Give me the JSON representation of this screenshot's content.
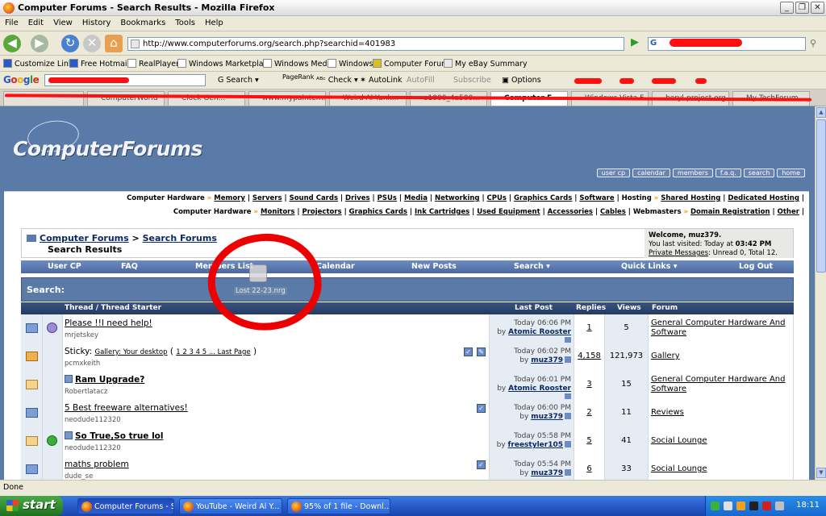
{
  "window": {
    "title": "Computer Forums - Search Results - Mozilla Firefox"
  },
  "menu": [
    "File",
    "Edit",
    "View",
    "History",
    "Bookmarks",
    "Tools",
    "Help"
  ],
  "nav": {
    "url": "http://www.computerforums.org/search.php?searchid=401983"
  },
  "bookmarks": [
    "Customize Links",
    "Free Hotmail",
    "RealPlayer",
    "Windows Marketplace",
    "Windows Media",
    "Windows",
    "Computer Forums",
    "My eBay Summary"
  ],
  "google_toolbar": {
    "logo": "Google",
    "search": "Search",
    "pagerank": "PageRank",
    "check": "Check",
    "autolink": "AutoLink",
    "autofill": "AutoFill",
    "subscribe": "Subscribe",
    "options": "Options"
  },
  "tabs": [
    "ComputerWorld",
    "Clock Gen...",
    "www.mypaintem...",
    "Weird Al Yank...",
    "a1000_4a500...",
    "Computer F...",
    "Windows Vista F...",
    "beryl-project.org",
    "My TechForum..."
  ],
  "site": {
    "logo": "ComputerForums",
    "header_buttons": [
      "user cp",
      "calendar",
      "members",
      "f.a.q.",
      "search",
      "home"
    ],
    "link_row1": {
      "lead": "Computer Hardware",
      "items": [
        "Memory",
        "Servers",
        "Sound Cards",
        "Drives",
        "PSUs",
        "Media",
        "Networking",
        "CPUs",
        "Graphics Cards",
        "Software"
      ],
      "lead2": "Hosting",
      "items2": [
        "Shared Hosting",
        "Dedicated Hosting"
      ]
    },
    "link_row2": {
      "lead": "Computer Hardware",
      "items": [
        "Monitors",
        "Projectors",
        "Graphics Cards",
        "Ink Cartridges",
        "Used Equipment",
        "Accessories",
        "Cables"
      ],
      "lead2": "Webmasters",
      "items2": [
        "Domain Registration",
        "Other"
      ]
    },
    "breadcrumb": {
      "root": "Computer Forums",
      "sep": ">",
      "section": "Search Forums",
      "current": "Search Results"
    },
    "welcome": {
      "line1": "Welcome, muz379.",
      "line2": "You last visited: Today at",
      "time": "03:42 PM",
      "pm_link": "Private Messages",
      "pm_text": ": Unread 0, Total 12."
    },
    "navstrip": [
      "User CP",
      "FAQ",
      "Members List",
      "Calendar",
      "New Posts",
      "Search ▾",
      "Quick Links ▾",
      "Log Out"
    ],
    "search_label": "Search:",
    "drag_label": "Lost 22-23.nrg",
    "table_headers": {
      "thread": "Thread / Thread Starter",
      "lastpost": "Last Post",
      "replies": "Replies",
      "views": "Views",
      "forum": "Forum"
    },
    "threads": [
      {
        "title": "Please !!I need help!",
        "starter": "mrjetskey",
        "date": "Today 06:06 PM",
        "by": "by",
        "user": "Atomic Rooster",
        "replies": "1",
        "views": "5",
        "forum": "General Computer Hardware And Software"
      },
      {
        "title": "Gallery: Your desktop",
        "prefix": "Sticky:",
        "pages": "1 2 3 4 5 ... Last Page",
        "starter": "pcmxkeith",
        "date": "Today 06:02 PM",
        "by": "by",
        "user": "muz379",
        "replies": "4,158",
        "views": "121,973",
        "forum": "Gallery"
      },
      {
        "title": "Ram Upgrade?",
        "starter": "Robertlatacz",
        "date": "Today 06:01 PM",
        "by": "by",
        "user": "Atomic Rooster",
        "replies": "3",
        "views": "15",
        "forum": "General Computer Hardware And Software"
      },
      {
        "title": "5 Best freeware alternatives!",
        "starter": "neodude112320",
        "date": "Today 06:00 PM",
        "by": "by",
        "user": "muz379",
        "replies": "2",
        "views": "11",
        "forum": "Reviews"
      },
      {
        "title": "So True,So true lol",
        "starter": "neodude112320",
        "date": "Today 05:58 PM",
        "by": "by",
        "user": "freestyler105",
        "replies": "5",
        "views": "41",
        "forum": "Social Lounge"
      },
      {
        "title": "maths problem",
        "starter": "dude_se",
        "date": "Today 05:54 PM",
        "by": "by",
        "user": "muz379",
        "replies": "6",
        "views": "33",
        "forum": "Social Lounge"
      }
    ]
  },
  "status": "Done",
  "taskbar": {
    "start": "start",
    "items": [
      "Computer Forums - S...",
      "YouTube - Weird Al Y...",
      "95% of 1 file - Downl..."
    ],
    "clock": "18:11"
  }
}
